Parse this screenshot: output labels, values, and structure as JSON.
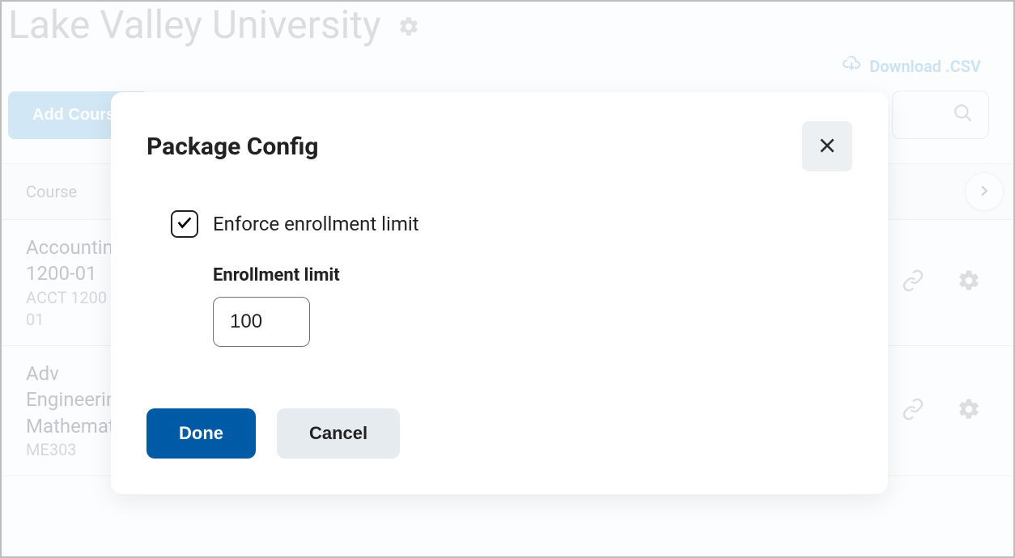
{
  "page": {
    "title": "Lake Valley University"
  },
  "actions": {
    "download_label": "Download .CSV",
    "add_course_label": "Add Course"
  },
  "table": {
    "header_course": "Course"
  },
  "rows": [
    {
      "title_line1": "Accounting",
      "title_line2": "1200-01",
      "code_line1": "ACCT 1200",
      "code_line2": "01"
    },
    {
      "title_line1": "Adv",
      "title_line2": "Engineering",
      "title_line3": "Mathematics",
      "code_line1": "ME303"
    }
  ],
  "modal": {
    "title": "Package Config",
    "checkbox_label": "Enforce enrollment limit",
    "checkbox_checked": true,
    "field_label": "Enrollment limit",
    "field_value": "100",
    "done_label": "Done",
    "cancel_label": "Cancel"
  }
}
